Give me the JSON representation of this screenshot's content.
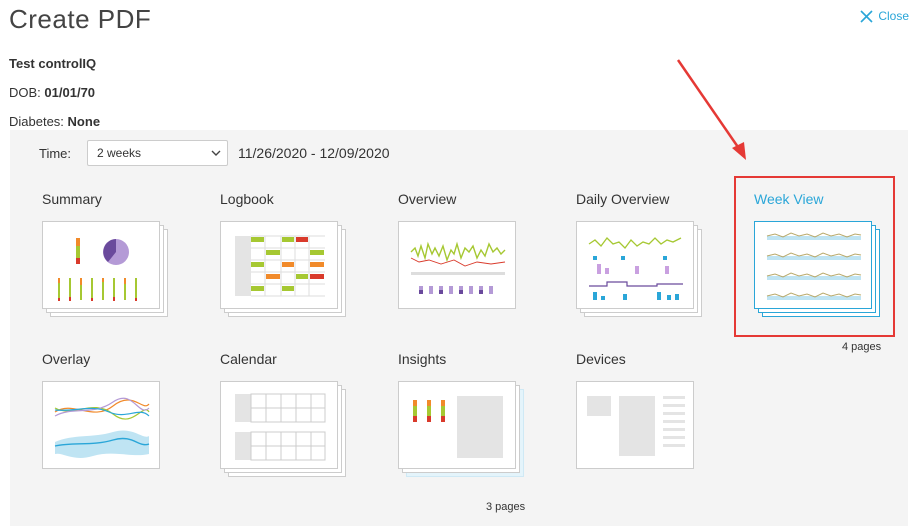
{
  "header": {
    "title": "Create PDF",
    "close_label": "Close"
  },
  "patient": {
    "name": "Test controlIQ",
    "dob_label": "DOB:",
    "dob_value": "01/01/70",
    "diabetes_label": "Diabetes:",
    "diabetes_value": "None"
  },
  "time": {
    "label": "Time:",
    "selected": "2 weeks",
    "range": "11/26/2020 - 12/09/2020"
  },
  "reports": {
    "summary": "Summary",
    "logbook": "Logbook",
    "overview": "Overview",
    "daily_overview": "Daily Overview",
    "week_view": "Week View",
    "week_view_pages": "4 pages",
    "overlay": "Overlay",
    "calendar": "Calendar",
    "insights": "Insights",
    "insights_pages": "3 pages",
    "devices": "Devices",
    "selected": "week_view"
  },
  "colors": {
    "accent": "#2aa6d8",
    "annotation": "#e53935",
    "low": "#d93a2b",
    "in_range": "#a6c832",
    "high": "#f18a2a",
    "purple": "#6a4a9c"
  }
}
